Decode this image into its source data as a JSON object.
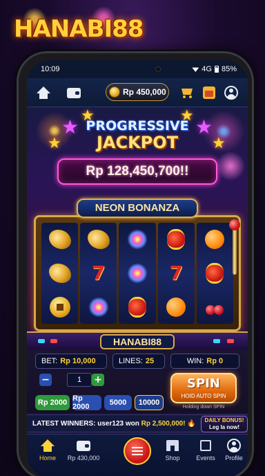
{
  "brand": {
    "logo_text": "HANABI88"
  },
  "status_bar": {
    "time": "10:09",
    "network": "4G",
    "battery": "85%"
  },
  "top_nav": {
    "balance": "Rp 450,000",
    "icons": [
      "home-icon",
      "wallet-icon",
      "coin-icon",
      "cart-icon",
      "calendar-icon",
      "profile-icon"
    ]
  },
  "hero": {
    "title_top": "PROGRESSIVE",
    "title_main": "JACKPOT",
    "jackpot_amount": "Rp 128,450,700!!"
  },
  "machine": {
    "name": "NEON BONANZA",
    "base_label": "HANABI88",
    "reels": [
      [
        "dragon",
        "dragon",
        "coin"
      ],
      [
        "dragon",
        "seven",
        "fireworks"
      ],
      [
        "fireworks",
        "fireworks",
        "lantern"
      ],
      [
        "lantern",
        "seven",
        "orange"
      ],
      [
        "orange",
        "lantern",
        "cherry"
      ]
    ],
    "seven_glyph": "7"
  },
  "controls": {
    "bet_label": "BET:",
    "bet_value": "Rp 10,000",
    "lines_label": "LINES:",
    "lines_value": "25",
    "win_label": "WIN:",
    "win_value": "Rp 0",
    "stepper_minus": "−",
    "stepper_plus": "+",
    "stepper_value": "1",
    "quick_bets": [
      "Rp 2000",
      "Rp 2000",
      "5000",
      "10000"
    ],
    "spin_label": "SPIN",
    "spin_sub": "HOID AUTO SPIN",
    "hold_hint": "Holding down SPIN"
  },
  "ticker": {
    "prefix": "LATEST WINNERS: user123 won ",
    "amount": "Rp 2,500,000!",
    "flame": "🔥",
    "bonus_title": "DAILY BONUS!",
    "bonus_sub": "Leg la now!"
  },
  "bottom_nav": {
    "items": [
      {
        "label": "Home",
        "icon": "home-icon",
        "active": true
      },
      {
        "label": "Rp 430,000",
        "icon": "wallet-icon",
        "active": false
      },
      {
        "label": "",
        "icon": "menu-icon",
        "active": false
      },
      {
        "label": "Shop",
        "icon": "shop-icon",
        "active": false
      },
      {
        "label": "Events",
        "icon": "calendar-icon",
        "active": false
      },
      {
        "label": "Profile",
        "icon": "profile-icon",
        "active": false
      }
    ]
  },
  "colors": {
    "accent_gold": "#ffd23a",
    "jackpot_pink": "#ff5ad7",
    "spin_orange": "#e06a10",
    "chip_green": "#2f9a3c",
    "chip_blue": "#2a4fb0"
  }
}
